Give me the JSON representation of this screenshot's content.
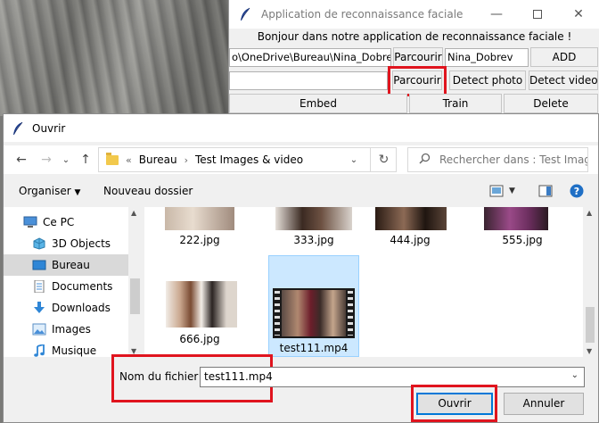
{
  "app": {
    "title": "Application de reconnaissance faciale",
    "greeting": "Bonjour dans notre application de reconnaissance faciale !",
    "path_value": "o\\OneDrive\\Bureau\\Nina_Dobrev",
    "browse_label_1": "Parcourir",
    "name_value": "Nina_Dobrev",
    "add_label": "ADD",
    "image_path_value": "",
    "browse_label_2": "Parcourir",
    "detect_photo_label": "Detect photo",
    "detect_video_label": "Detect video",
    "embed_label": "Embed",
    "train_label": "Train",
    "delete_label": "Delete"
  },
  "dialog": {
    "title": "Ouvrir",
    "breadcrumb": [
      "«",
      "Bureau",
      "Test Images & video"
    ],
    "search_placeholder": "Rechercher dans : Test Imag...",
    "organize_label": "Organiser",
    "new_folder_label": "Nouveau dossier",
    "nav_items": [
      {
        "label": "Ce PC",
        "icon": "pc-icon"
      },
      {
        "label": "3D Objects",
        "icon": "cube-icon"
      },
      {
        "label": "Bureau",
        "icon": "desktop-icon",
        "selected": true
      },
      {
        "label": "Documents",
        "icon": "documents-icon"
      },
      {
        "label": "Downloads",
        "icon": "download-icon"
      },
      {
        "label": "Images",
        "icon": "images-icon"
      },
      {
        "label": "Musique",
        "icon": "music-icon"
      }
    ],
    "files": [
      {
        "name": "222.jpg"
      },
      {
        "name": "333.jpg"
      },
      {
        "name": "444.jpg"
      },
      {
        "name": "555.jpg"
      },
      {
        "name": "666.jpg"
      },
      {
        "name": "test111.mp4",
        "selected": true
      }
    ],
    "filename_label": "Nom du fichier :",
    "filename_value": "test111.mp4",
    "open_label": "Ouvrir",
    "cancel_label": "Annuler"
  },
  "colors": {
    "highlight": "#e0141e",
    "selection": "#cce8ff",
    "accent": "#0078d7"
  }
}
